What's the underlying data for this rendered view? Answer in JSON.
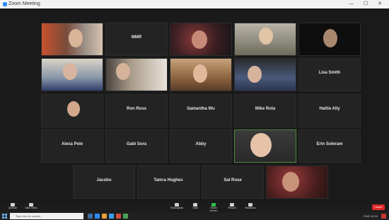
{
  "window": {
    "title": "Zoom Meeting",
    "controls": "— ☐ ✕"
  },
  "colors": {
    "titlebar": "#f2f2f2",
    "gallery": "#1a1a1a",
    "tile": "#232323",
    "leave": "#e02828",
    "taskbar": "#202020"
  },
  "tiles": [
    {
      "name": "",
      "label": ""
    },
    {
      "name": "MMR",
      "label": ""
    },
    {
      "name": "",
      "label": ""
    },
    {
      "name": "",
      "label": ""
    },
    {
      "name": "",
      "label": ""
    },
    {
      "name": "",
      "label": ""
    },
    {
      "name": "",
      "label": ""
    },
    {
      "name": "",
      "label": ""
    },
    {
      "name": "",
      "label": ""
    },
    {
      "name": "Lisa Smith",
      "label": ""
    },
    {
      "name": "",
      "label": ""
    },
    {
      "name": "Ron Ross",
      "label": ""
    },
    {
      "name": "Samantha Wu",
      "label": ""
    },
    {
      "name": "Mike Rota",
      "label": ""
    },
    {
      "name": "Hattie Ally",
      "label": ""
    },
    {
      "name": "Alexa Pole",
      "label": ""
    },
    {
      "name": "Gabi Sora",
      "label": ""
    },
    {
      "name": "Abby",
      "label": ""
    },
    {
      "name": "",
      "label": ""
    },
    {
      "name": "Erin Soleram",
      "label": ""
    },
    {
      "name": "Jacobo",
      "label": ""
    },
    {
      "name": "Tamra Hughes",
      "label": ""
    },
    {
      "name": "Sal Rose",
      "label": ""
    },
    {
      "name": "",
      "label": ""
    }
  ],
  "toolbar": {
    "unmute": "Unmute",
    "video": "Start Video",
    "participants": "Participants",
    "chat": "Chat",
    "share": "Share Screen",
    "record": "Record",
    "reactions": "Reactions",
    "leave": "Leave"
  },
  "taskbar": {
    "search_placeholder": "Type here to search",
    "tray": "ENG 10:32"
  }
}
